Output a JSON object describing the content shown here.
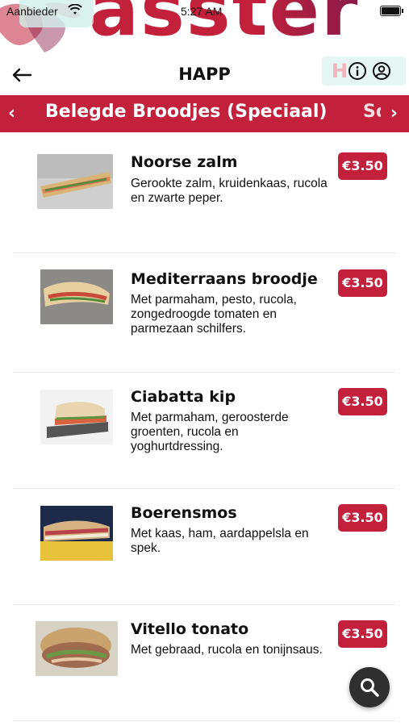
{
  "status_bar": {
    "carrier": "Aanbieder",
    "time": "5:27 AM"
  },
  "header": {
    "title": "HAPP",
    "back_icon": "arrow-left-icon",
    "info_icon": "info-icon",
    "user_icon": "user-icon"
  },
  "category_nav": {
    "active": "Belegde Broodjes (Speciaal)",
    "next_peek": "So",
    "prev_icon": "chevron-left-icon",
    "next_icon": "chevron-right-icon"
  },
  "products": [
    {
      "name": "Noorse zalm",
      "description": "Gerookte zalm, kruidenkaas, rucola en zwarte peper.",
      "price": "€3.50"
    },
    {
      "name": "Mediterraans broodje",
      "description": "Met parmaham, pesto, rucola, zongedroogde tomaten en parmezaan schilfers.",
      "price": "€3.50"
    },
    {
      "name": "Ciabatta kip",
      "description": "Met parmaham, geroosterde groenten, rucola en yoghurtdressing.",
      "price": "€3.50"
    },
    {
      "name": "Boerensmos",
      "description": "Met kaas, ham, aardappelsla en spek.",
      "price": "€3.50"
    },
    {
      "name": "Vitello tonato",
      "description": "Met gebraad, rucola en tonijnsaus.",
      "price": "€3.50"
    }
  ],
  "fab": {
    "icon": "search-icon"
  },
  "colors": {
    "brand": "#c3203b",
    "fab": "#2f2f2f"
  }
}
